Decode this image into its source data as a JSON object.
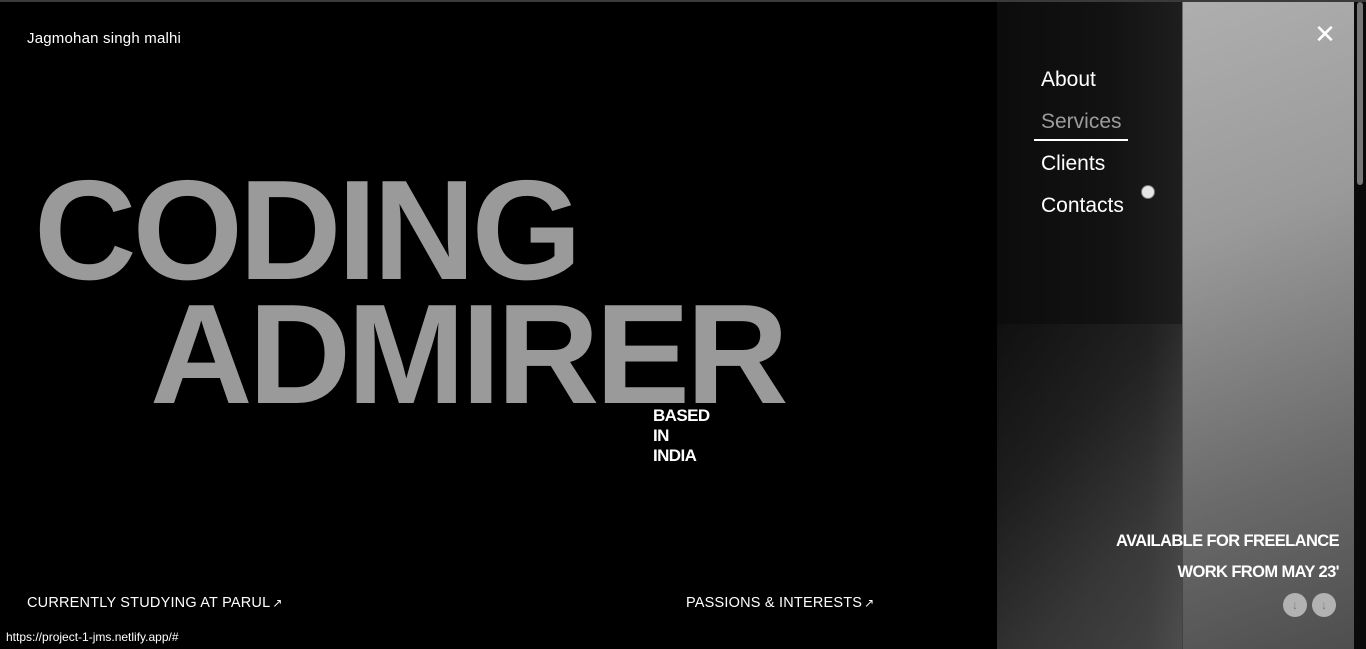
{
  "header": {
    "author_name": "Jagmohan singh malhi"
  },
  "hero": {
    "line1": "CODING",
    "line2": "ADMIRER",
    "subtitle": "BASED IN INDIA"
  },
  "footer": {
    "left_link": "CURRENTLY STUDYING AT PARUL",
    "right_link": "PASSIONS & INTERESTS",
    "arrow_glyph": "↗"
  },
  "menu": {
    "close_glyph": "✕",
    "items": [
      {
        "label": "About"
      },
      {
        "label": "Services",
        "active": true
      },
      {
        "label": "Clients"
      },
      {
        "label": "Contacts"
      }
    ],
    "availability_line1": "AVAILABLE FOR FREELANCE",
    "availability_line2": "WORK FROM MAY 23'",
    "scroll_glyph": "↓"
  },
  "status": {
    "url": "https://project-1-jms.netlify.app/#"
  },
  "colors": {
    "hero_text": "#9a9a9a",
    "background": "#000000",
    "active_menu": "#9c9c9c"
  },
  "icons": {
    "close": "close-icon",
    "arrow_out": "arrow-up-right-icon",
    "scroll": "arrow-down-icon"
  }
}
